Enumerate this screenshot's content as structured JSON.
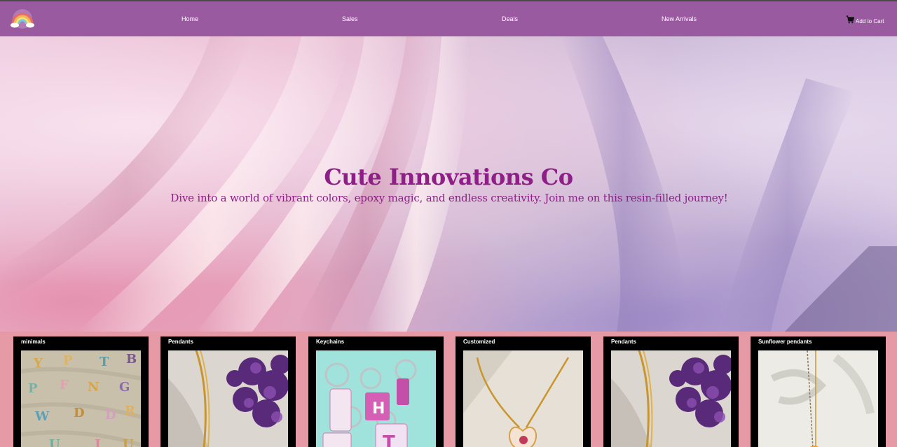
{
  "nav": {
    "logo_icon": "rainbow-logo-icon",
    "links": [
      "Home",
      "Sales",
      "Deals",
      "New Arrivals"
    ],
    "cart_label": "Add to Cart",
    "cart_icon": "cart-icon",
    "background": "#9a5aa0"
  },
  "hero": {
    "title": "Cute Innovations Co",
    "subtitle": "Dive into a world of vibrant colors, epoxy magic, and endless creativity. Join me on this resin-filled journey!",
    "title_color": "#8e1f86"
  },
  "products": [
    {
      "title": "minimals"
    },
    {
      "title": "Pendants"
    },
    {
      "title": "Keychains"
    },
    {
      "title": "Customized"
    },
    {
      "title": "Pendants"
    },
    {
      "title": "Sunflower pendants"
    }
  ],
  "colors": {
    "page_bg": "#e59aa6",
    "card_bg": "#000000"
  }
}
